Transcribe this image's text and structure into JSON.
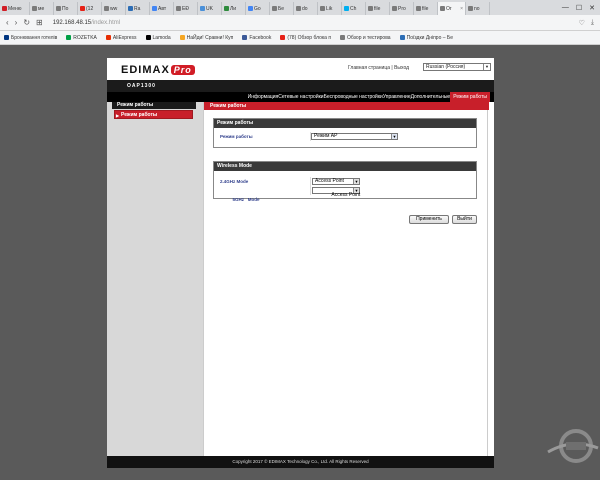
{
  "browser": {
    "tabs": [
      {
        "label": "Меню",
        "color": "#d11d26"
      },
      {
        "label": "ме",
        "color": "#7a7a7a"
      },
      {
        "label": "По",
        "color": "#7a7a7a"
      },
      {
        "label": "(12",
        "color": "#e62117"
      },
      {
        "label": "ww",
        "color": "#7a7a7a"
      },
      {
        "label": "Ra",
        "color": "#2c6db5"
      },
      {
        "label": "Авт",
        "color": "#4285f4"
      },
      {
        "label": "EĐ",
        "color": "#7a7a7a"
      },
      {
        "label": "UK",
        "color": "#4a90d9"
      },
      {
        "label": "Ли",
        "color": "#2e8b3d"
      },
      {
        "label": "Go",
        "color": "#4285f4"
      },
      {
        "label": "Бе",
        "color": "#7a7a7a"
      },
      {
        "label": "do",
        "color": "#7a7a7a"
      },
      {
        "label": "Lik",
        "color": "#7a7a7a"
      },
      {
        "label": "Ch",
        "color": "#00aff0"
      },
      {
        "label": "file",
        "color": "#7a7a7a"
      },
      {
        "label": "Pro",
        "color": "#7a7a7a"
      },
      {
        "label": "file",
        "color": "#7a7a7a"
      },
      {
        "label": "Or",
        "color": "#7a7a7a"
      },
      {
        "label": "no",
        "color": "#7a7a7a"
      }
    ],
    "url_host": "192.168.48.15",
    "url_path": "/index.html",
    "bookmarks": [
      {
        "label": "Бронювання готелів",
        "color": "#003580"
      },
      {
        "label": "ROZETKA",
        "color": "#00a046"
      },
      {
        "label": "AliExpress",
        "color": "#e62e04"
      },
      {
        "label": "Lamoda",
        "color": "#000000"
      },
      {
        "label": "НаЙди! Сравни! Куп",
        "color": "#f5a623"
      },
      {
        "label": "Facebook",
        "color": "#3b5998"
      },
      {
        "label": "(78) Обзор блока п",
        "color": "#e62117"
      },
      {
        "label": "Обзор и тестирова",
        "color": "#7a7a7a"
      },
      {
        "label": "Поїздки Дніпро – Бе",
        "color": "#2c6db5"
      }
    ]
  },
  "header": {
    "logo_text": "EDIMAX",
    "logo_badge": "Pro",
    "home_link": "Главная страница",
    "separator": "|",
    "logout_link": "Выход",
    "language_value": "Russian (Россия)",
    "model": "OAP1300"
  },
  "menu": {
    "items": [
      {
        "label": "Информация",
        "active": false
      },
      {
        "label": "Сетевые настройки",
        "active": false
      },
      {
        "label": "Беспроводные настройки",
        "active": false
      },
      {
        "label": "Управление",
        "active": false
      },
      {
        "label": "Дополнительные",
        "active": false
      },
      {
        "label": "Режим работы",
        "active": true
      }
    ]
  },
  "sidebar": {
    "title": "Режим работы",
    "items": [
      {
        "label": "Режим работы"
      }
    ]
  },
  "main": {
    "title": "Режим работы",
    "mode_panel": {
      "heading": "Режим работы",
      "row_label": "Режим работы",
      "row_value": "Режим AP"
    },
    "wireless_panel": {
      "heading": "Wireless Mode",
      "rows": [
        {
          "label": "2.4GHz Mode",
          "value": "Access Point"
        },
        {
          "label": "5GHz   Mode",
          "value": "Access Point"
        }
      ]
    },
    "apply_button": "Применить",
    "exit_button": "Выйти"
  },
  "footer": {
    "copyright": "Copyright 2017 © EDIMAX Technology Co., Ltd. All Rights Reserved"
  },
  "watermark": {
    "text": "GECID.COM"
  }
}
